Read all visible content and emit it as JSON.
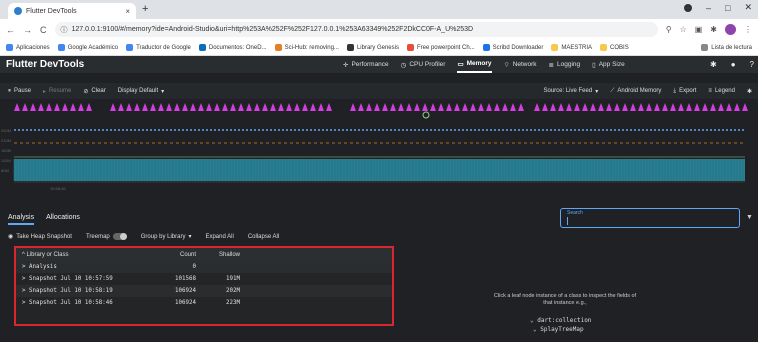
{
  "browser": {
    "tab_title": "Flutter DevTools",
    "tab_close": "×",
    "new_tab": "+",
    "url_main": "127.0.0.1:9100/#/memory?ide=Android-Studio&uri=http%253A%252F%252F127.0.0.1%253A63349%252F2DkCC0F-A_U%253D",
    "bookmarks": [
      "Aplicaciones",
      "Google Académico",
      "Traductor de Google",
      "Documentos: OneD...",
      "Sci-Hub: removing...",
      "Library Genesis",
      "Free powerpoint Ch...",
      "Scribd Downloader",
      "MAESTRIA",
      "COBIS"
    ],
    "bookmark_right": "Lista de lectura",
    "win_minimize": "–",
    "win_maximize": "□",
    "win_close": "✕"
  },
  "devtools": {
    "title": "Flutter DevTools",
    "tabs": [
      "Performance",
      "CPU Profiler",
      "Memory",
      "Network",
      "Logging",
      "App Size"
    ],
    "active_tab": "Memory"
  },
  "toolbar": {
    "pause": "Pause",
    "resume": "Resume",
    "clear": "Clear",
    "display": "Display Default",
    "source": "Source: Live Feed",
    "android_memory": "Android Memory",
    "export": "Export",
    "legend": "Legend"
  },
  "chart": {
    "time_label": "10:58:46",
    "y_ticks": [
      "260M",
      "210M",
      "160M",
      "110M",
      "60M"
    ]
  },
  "section_tabs": [
    "Analysis",
    "Allocations"
  ],
  "search": {
    "label": "Search"
  },
  "heap_toolbar": {
    "snapshot": "Take Heap Snapshot",
    "treemap": "Treemap",
    "group_by": "Group by Library",
    "expand_all": "Expand All",
    "collapse_all": "Collapse All"
  },
  "table": {
    "headers": [
      "Library or Class",
      "Count",
      "Shallow"
    ],
    "rows": [
      {
        "name": "Analysis",
        "count": "0",
        "shallow": ""
      },
      {
        "name": "Snapshot Jul 10 10:57:59",
        "count": "101568",
        "shallow": "191M"
      },
      {
        "name": "Snapshot Jul 10 10:58:19",
        "count": "106924",
        "shallow": "202M"
      },
      {
        "name": "Snapshot Jul 10 10:58:46",
        "count": "106924",
        "shallow": "223M"
      }
    ]
  },
  "detail": {
    "hint": "Click a leaf node instance of a class to inspect the fields of that instance e.g.,",
    "tree_1": "dart:collection",
    "tree_2": "SplayTreeMap"
  },
  "colors": {
    "accent": "#5fa8f5",
    "highlight": "#d9262f",
    "events": "#d13fe0",
    "series_teal": "#2c8fa5"
  }
}
